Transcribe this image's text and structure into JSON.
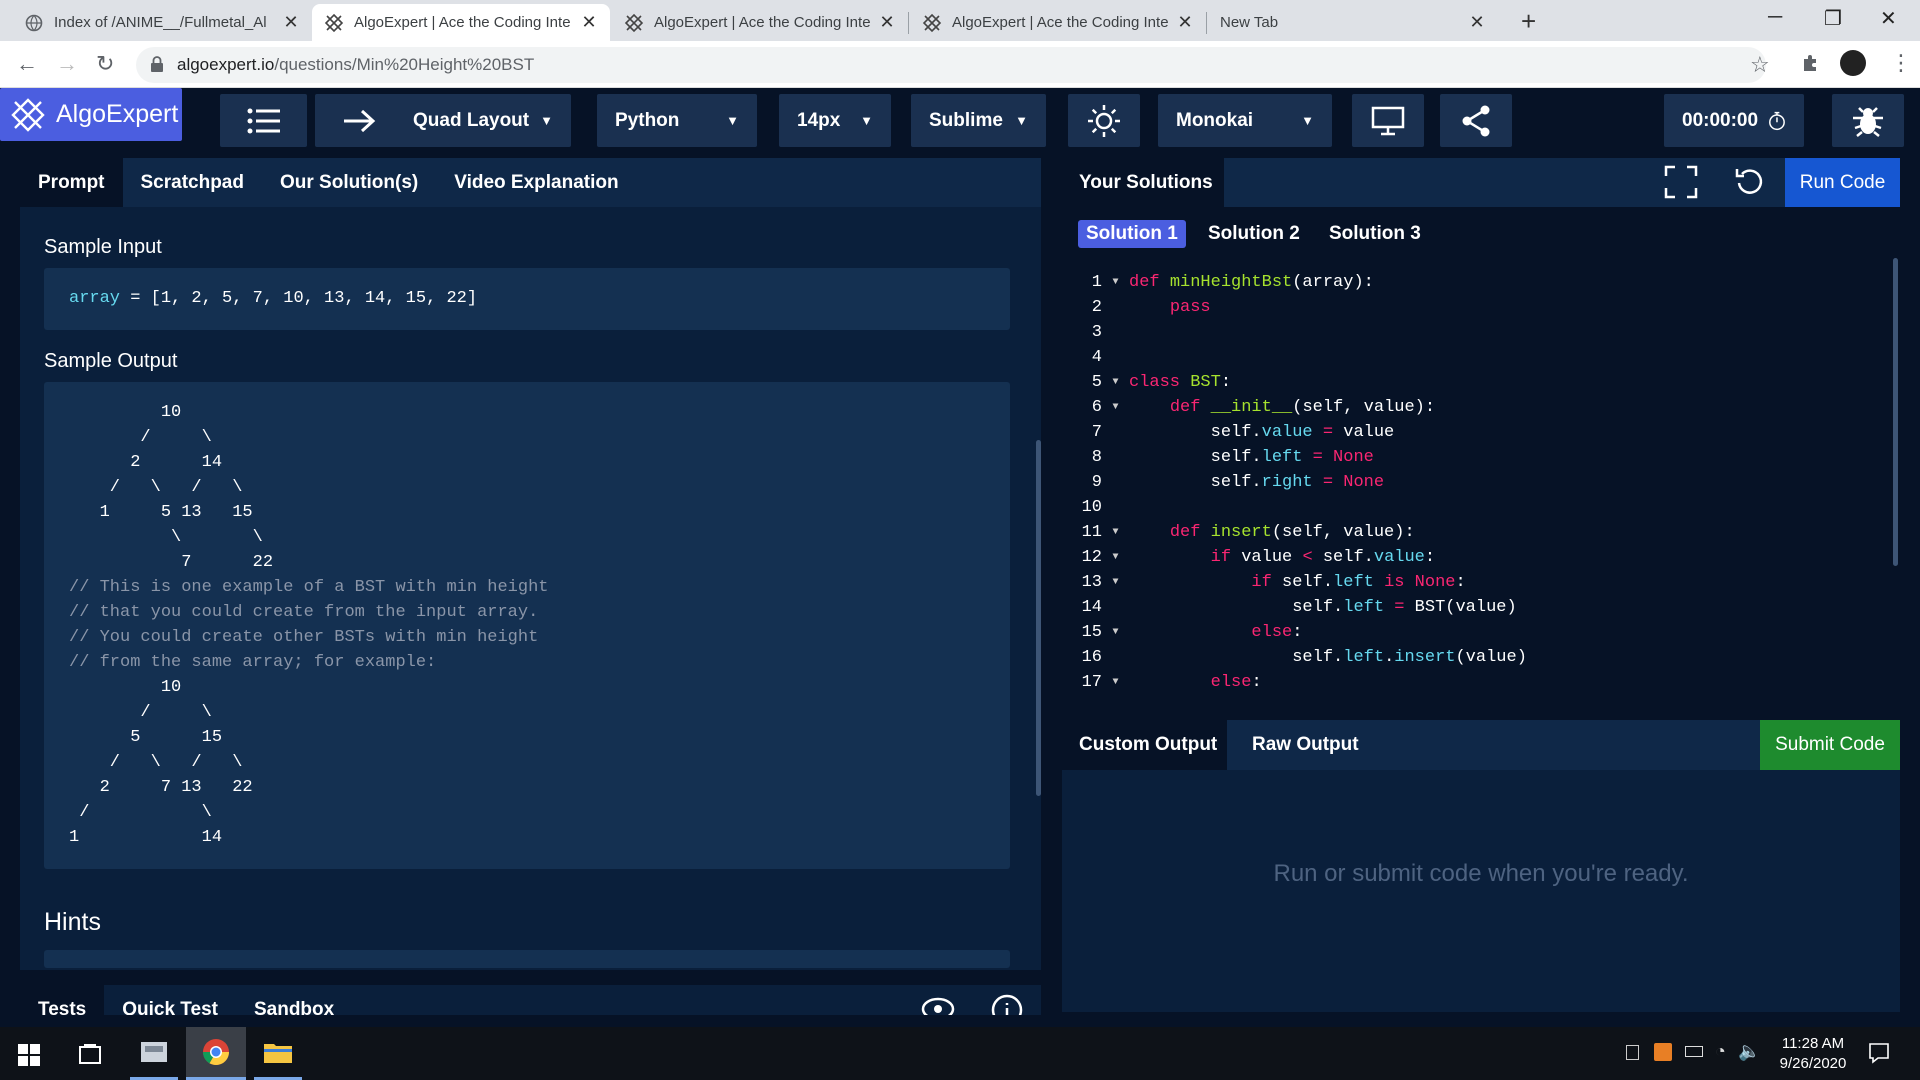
{
  "browser": {
    "tabs": [
      {
        "title": "Index of /ANIME__/Fullmetal_Al",
        "active": false
      },
      {
        "title": "AlgoExpert | Ace the Coding Inte",
        "active": true
      },
      {
        "title": "AlgoExpert | Ace the Coding Inte",
        "active": false
      },
      {
        "title": "AlgoExpert | Ace the Coding Inte",
        "active": false
      },
      {
        "title": "New Tab",
        "active": false
      }
    ],
    "url_domain": "algoexpert.io",
    "url_path": "/questions/Min%20Height%20BST"
  },
  "app": {
    "logo_text": "AlgoExpert",
    "layout_label": "Quad Layout",
    "language_label": "Python",
    "fontsize_label": "14px",
    "keymap_label": "Sublime",
    "theme_label": "Monokai",
    "timer": "00:00:00"
  },
  "left": {
    "tabs": [
      "Prompt",
      "Scratchpad",
      "Our Solution(s)",
      "Video Explanation"
    ],
    "sample_input_heading": "Sample Input",
    "sample_input_var": "array",
    "sample_input_rest": " = [1, 2, 5, 7, 10, 13, 14, 15, 22]",
    "sample_output_heading": "Sample Output",
    "tree1": "         10\n       /     \\\n      2      14\n    /   \\   /   \\\n   1     5 13   15\n          \\       \\\n           7      22",
    "comment": "// This is one example of a BST with min height\n// that you could create from the input array.\n// You could create other BSTs with min height\n// from the same array; for example:",
    "tree2": "         10\n       /     \\\n      5      15\n    /   \\   /   \\\n   2     7 13   22\n /           \\\n1            14",
    "hints_heading": "Hints",
    "bottom_tabs": [
      "Tests",
      "Quick Test",
      "Sandbox"
    ]
  },
  "right": {
    "title": "Your Solutions",
    "run_label": "Run Code",
    "solution_tabs": [
      "Solution 1",
      "Solution 2",
      "Solution 3"
    ],
    "output_tabs": [
      "Custom Output",
      "Raw Output"
    ],
    "submit_label": "Submit Code",
    "output_message": "Run or submit code when you're ready."
  },
  "code_lines": [
    {
      "n": "1",
      "fold": true,
      "html": "<span class='pink'>def</span> <span class='grn'>minHeightBst</span>(array):"
    },
    {
      "n": "2",
      "fold": false,
      "html": "    <span class='pink'>pass</span>"
    },
    {
      "n": "3",
      "fold": false,
      "html": ""
    },
    {
      "n": "4",
      "fold": false,
      "html": ""
    },
    {
      "n": "5",
      "fold": true,
      "html": "<span class='pink'>class</span> <span class='grn'>BST</span>:"
    },
    {
      "n": "6",
      "fold": true,
      "html": "    <span class='pink'>def</span> <span class='grn'>__init__</span>(self, value):"
    },
    {
      "n": "7",
      "fold": false,
      "html": "        self.<span class='var'>value</span> <span class='pink'>=</span> value"
    },
    {
      "n": "8",
      "fold": false,
      "html": "        self.<span class='var'>left</span> <span class='pink'>=</span> <span class='pink'>None</span>"
    },
    {
      "n": "9",
      "fold": false,
      "html": "        self.<span class='var'>right</span> <span class='pink'>=</span> <span class='pink'>None</span>"
    },
    {
      "n": "10",
      "fold": false,
      "html": ""
    },
    {
      "n": "11",
      "fold": true,
      "html": "    <span class='pink'>def</span> <span class='grn'>insert</span>(self, value):"
    },
    {
      "n": "12",
      "fold": true,
      "html": "        <span class='pink'>if</span> value <span class='pink'>&lt;</span> self.<span class='var'>value</span>:"
    },
    {
      "n": "13",
      "fold": true,
      "html": "            <span class='pink'>if</span> self.<span class='var'>left</span> <span class='pink'>is</span> <span class='pink'>None</span>:"
    },
    {
      "n": "14",
      "fold": false,
      "html": "                self.<span class='var'>left</span> <span class='pink'>=</span> BST(value)"
    },
    {
      "n": "15",
      "fold": true,
      "html": "            <span class='pink'>else</span>:"
    },
    {
      "n": "16",
      "fold": false,
      "html": "                self.<span class='var'>left</span>.<span class='var'>insert</span>(value)"
    },
    {
      "n": "17",
      "fold": true,
      "html": "        <span class='pink'>else</span>:"
    }
  ],
  "taskbar": {
    "time": "11:28 AM",
    "date": "9/26/2020"
  },
  "icons": [
    "windows-logo-icon",
    "task-view-icon",
    "algo-logo-icon",
    "menu-icon",
    "arrow-right-icon",
    "sun-icon",
    "monitor-icon",
    "share-icon",
    "timer-icon",
    "bug-icon",
    "fullscreen-icon",
    "reset-icon",
    "eye-icon",
    "info-icon"
  ]
}
